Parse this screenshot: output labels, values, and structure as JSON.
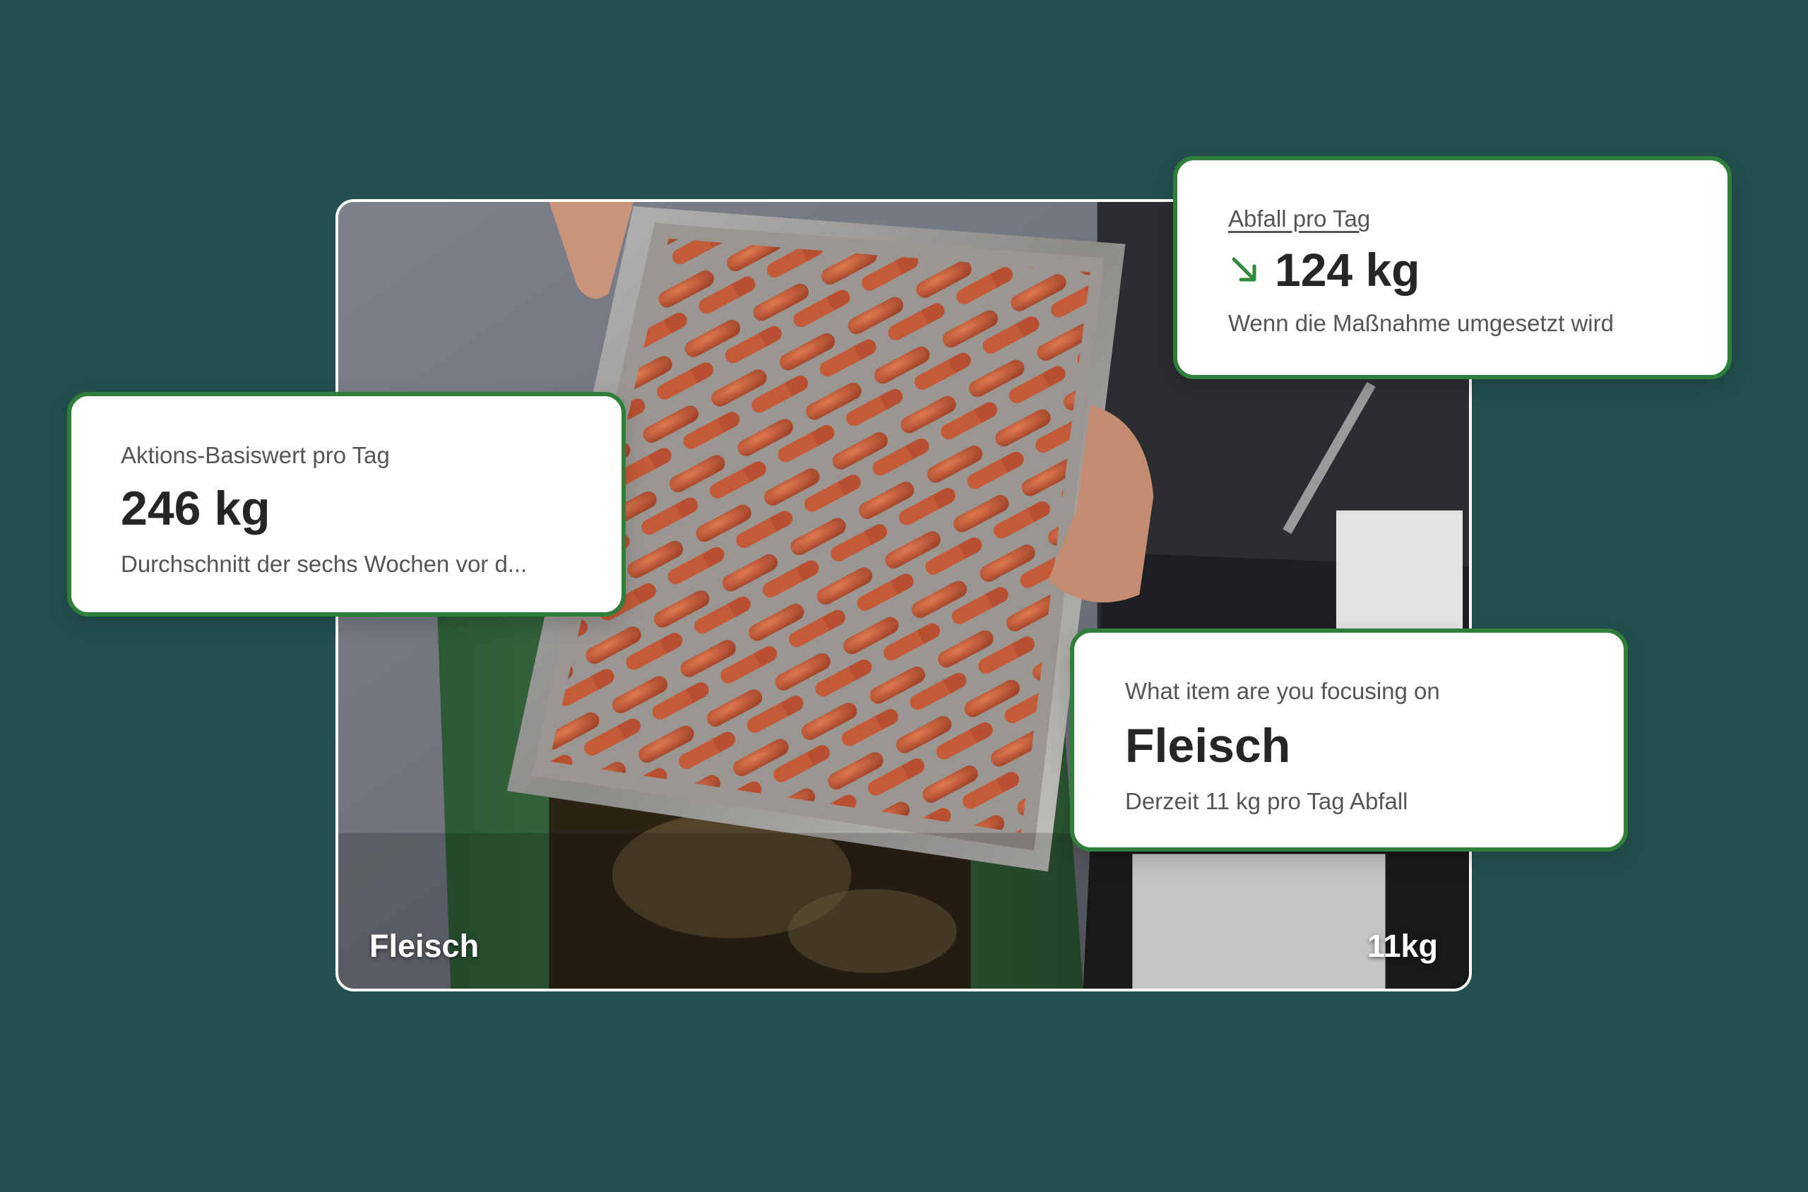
{
  "photo": {
    "caption_left": "Fleisch",
    "caption_right": "11kg"
  },
  "baseline_card": {
    "label": "Aktions-Basiswert pro Tag",
    "value": "246 kg",
    "subtitle": "Durchschnitt der sechs Wochen vor d..."
  },
  "waste_card": {
    "label": "Abfall pro Tag",
    "value": "124 kg",
    "subtitle": "Wenn die Maßnahme umgesetzt wird",
    "trend_icon": "arrow-down-right-icon"
  },
  "focus_card": {
    "label": "What item are you focusing on",
    "value": "Fleisch",
    "subtitle": "Derzeit 11 kg pro Tag Abfall"
  },
  "colors": {
    "background": "#23504f",
    "card_border": "#2f7f3a",
    "trend_arrow": "#2f8a3e"
  }
}
